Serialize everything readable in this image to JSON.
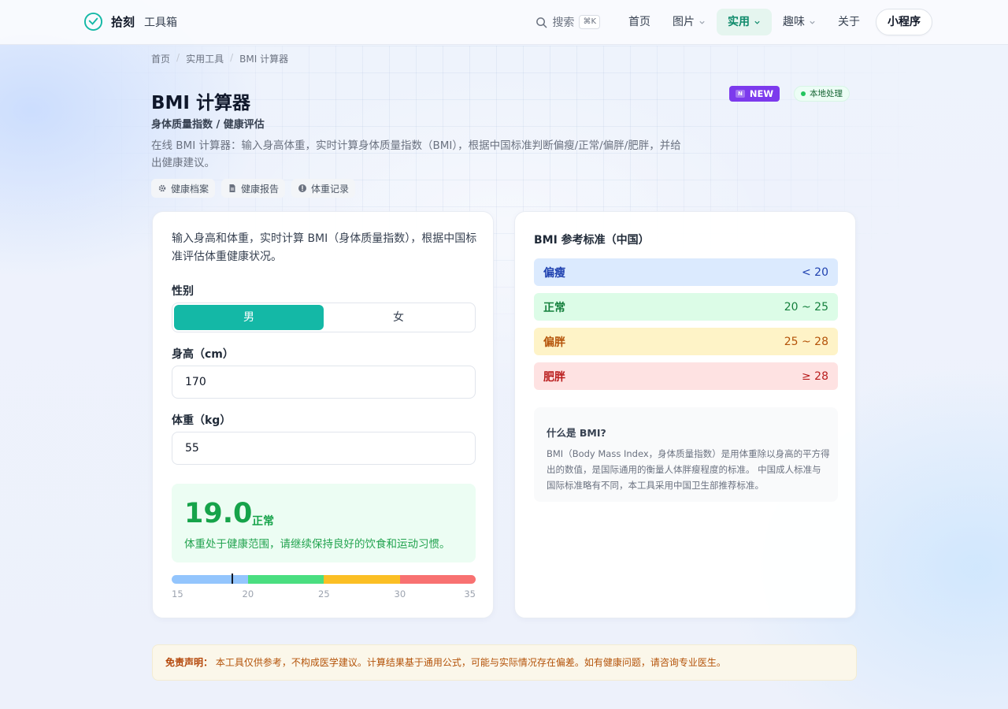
{
  "header": {
    "logo_name": "拾刻",
    "logo_sub": "工具箱",
    "search_label": "搜索",
    "search_kbd": "⌘K",
    "nav": [
      {
        "label": "首页"
      },
      {
        "label": "图片"
      },
      {
        "label": "实用"
      },
      {
        "label": "趣味"
      },
      {
        "label": "关于"
      }
    ],
    "mini_program": "小程序"
  },
  "breadcrumb": [
    "首页",
    "实用工具",
    "BMI 计算器"
  ],
  "page": {
    "title": "BMI 计算器",
    "subtitle": "身体质量指数 / 健康评估",
    "description": "在线 BMI 计算器：输入身高体重，实时计算身体质量指数（BMI），根据中国标准判断偏瘦/正常/偏胖/肥胖，并给出健康建议。",
    "badge_new": "NEW",
    "badge_new_icon": "N",
    "badge_local": "本地处理",
    "tags": [
      "健康档案",
      "健康报告",
      "体重记录"
    ]
  },
  "form": {
    "intro": "输入身高和体重，实时计算 BMI（身体质量指数），根据中国标准评估体重健康状况。",
    "gender_label": "性别",
    "gender_options": [
      "男",
      "女"
    ],
    "gender_selected": "男",
    "height_label": "身高（cm）",
    "height_value": "170",
    "weight_label": "体重（kg）",
    "weight_value": "55"
  },
  "result": {
    "bmi": "19.0",
    "bmi_value": 19.0,
    "category": "正常",
    "advice": "体重处于健康范围，请继续保持良好的饮食和运动习惯。"
  },
  "scale": {
    "min": 15,
    "max": 35,
    "ticks": [
      "15",
      "20",
      "25",
      "30",
      "35"
    ],
    "tick_values": [
      15,
      20,
      25,
      30,
      35
    ],
    "segments": [
      {
        "from": 15,
        "to": 20,
        "color": "#93c5fd"
      },
      {
        "from": 20,
        "to": 25,
        "color": "#4ade80"
      },
      {
        "from": 25,
        "to": 30,
        "color": "#fbbf24"
      },
      {
        "from": 30,
        "to": 35,
        "color": "#f87171"
      }
    ]
  },
  "reference": {
    "title": "BMI 参考标准（中国）",
    "rows": [
      {
        "name": "偏瘦",
        "range": "< 20",
        "bg": "#dbeafe",
        "fg": "#1e40af"
      },
      {
        "name": "正常",
        "range": "20 ~ 25",
        "bg": "#dcfce7",
        "fg": "#15803d"
      },
      {
        "name": "偏胖",
        "range": "25 ~ 28",
        "bg": "#fef3c7",
        "fg": "#b45309"
      },
      {
        "name": "肥胖",
        "range": "≥ 28",
        "bg": "#fee2e2",
        "fg": "#b91c1c"
      }
    ],
    "info_title": "什么是 BMI?",
    "info_text": "BMI（Body Mass Index，身体质量指数）是用体重除以身高的平方得出的数值，是国际通用的衡量人体胖瘦程度的标准。 中国成人标准与国际标准略有不同，本工具采用中国卫生部推荐标准。"
  },
  "disclaimer": {
    "label": "免责声明：",
    "text": "本工具仅供参考，不构成医学建议。计算结果基于通用公式，可能与实际情况存在偏差。如有健康问题，请咨询专业医生。"
  },
  "colors": {
    "accent": "#14b8a6",
    "nav_active_bg": "#e5f5ef",
    "result_green": "#16a34a",
    "badge_purple": "#7c3aed"
  }
}
